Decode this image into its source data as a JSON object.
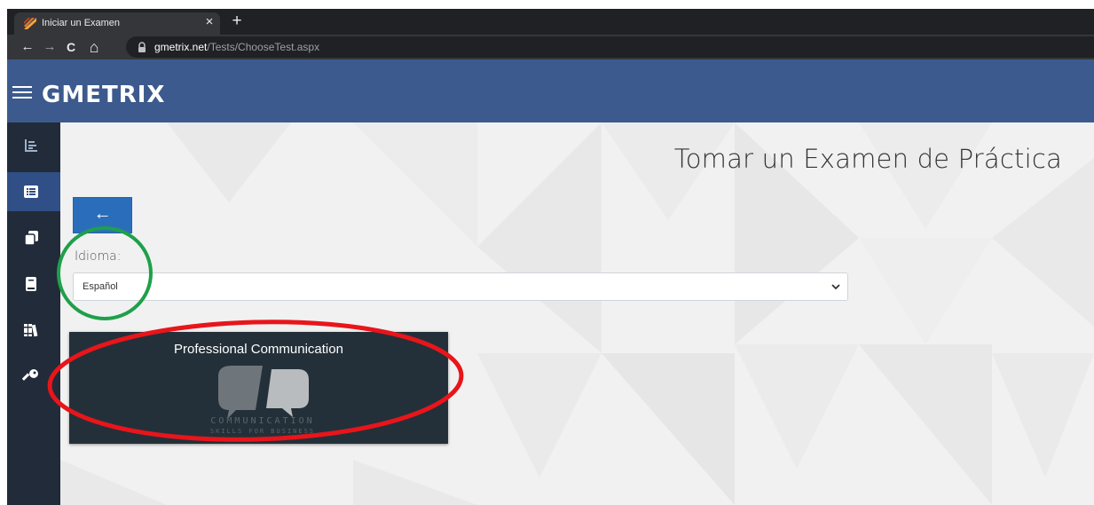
{
  "browser": {
    "tab_title": "Iniciar un Examen",
    "close_glyph": "×",
    "new_tab_glyph": "+",
    "back_glyph": "←",
    "forward_glyph": "→",
    "reload_glyph": "C",
    "home_glyph": "⌂",
    "url_host": "gmetrix.net",
    "url_path": "/Tests/ChooseTest.aspx"
  },
  "header": {
    "logo_text": "GMETRIX",
    "brand_color": "#3c5a8d"
  },
  "sidebar": {
    "items": [
      {
        "icon": "list-chart-icon",
        "active": false
      },
      {
        "icon": "list-icon",
        "active": true
      },
      {
        "icon": "copy-icon",
        "active": false
      },
      {
        "icon": "book-icon",
        "active": false
      },
      {
        "icon": "library-icon",
        "active": false
      },
      {
        "icon": "key-icon",
        "active": false
      }
    ]
  },
  "main": {
    "page_title": "Tomar un Examen de Práctica",
    "back_button_glyph": "←",
    "language_label": "Idioma:",
    "language_value": "Español",
    "exam_card": {
      "title": "Professional Communication",
      "art_text_line1": "COMMUNICATION",
      "art_text_line2": "SKILLS FOR BUSINESS"
    }
  },
  "annotations": {
    "green_color": "#1ea04a",
    "red_color": "#e8151b"
  }
}
